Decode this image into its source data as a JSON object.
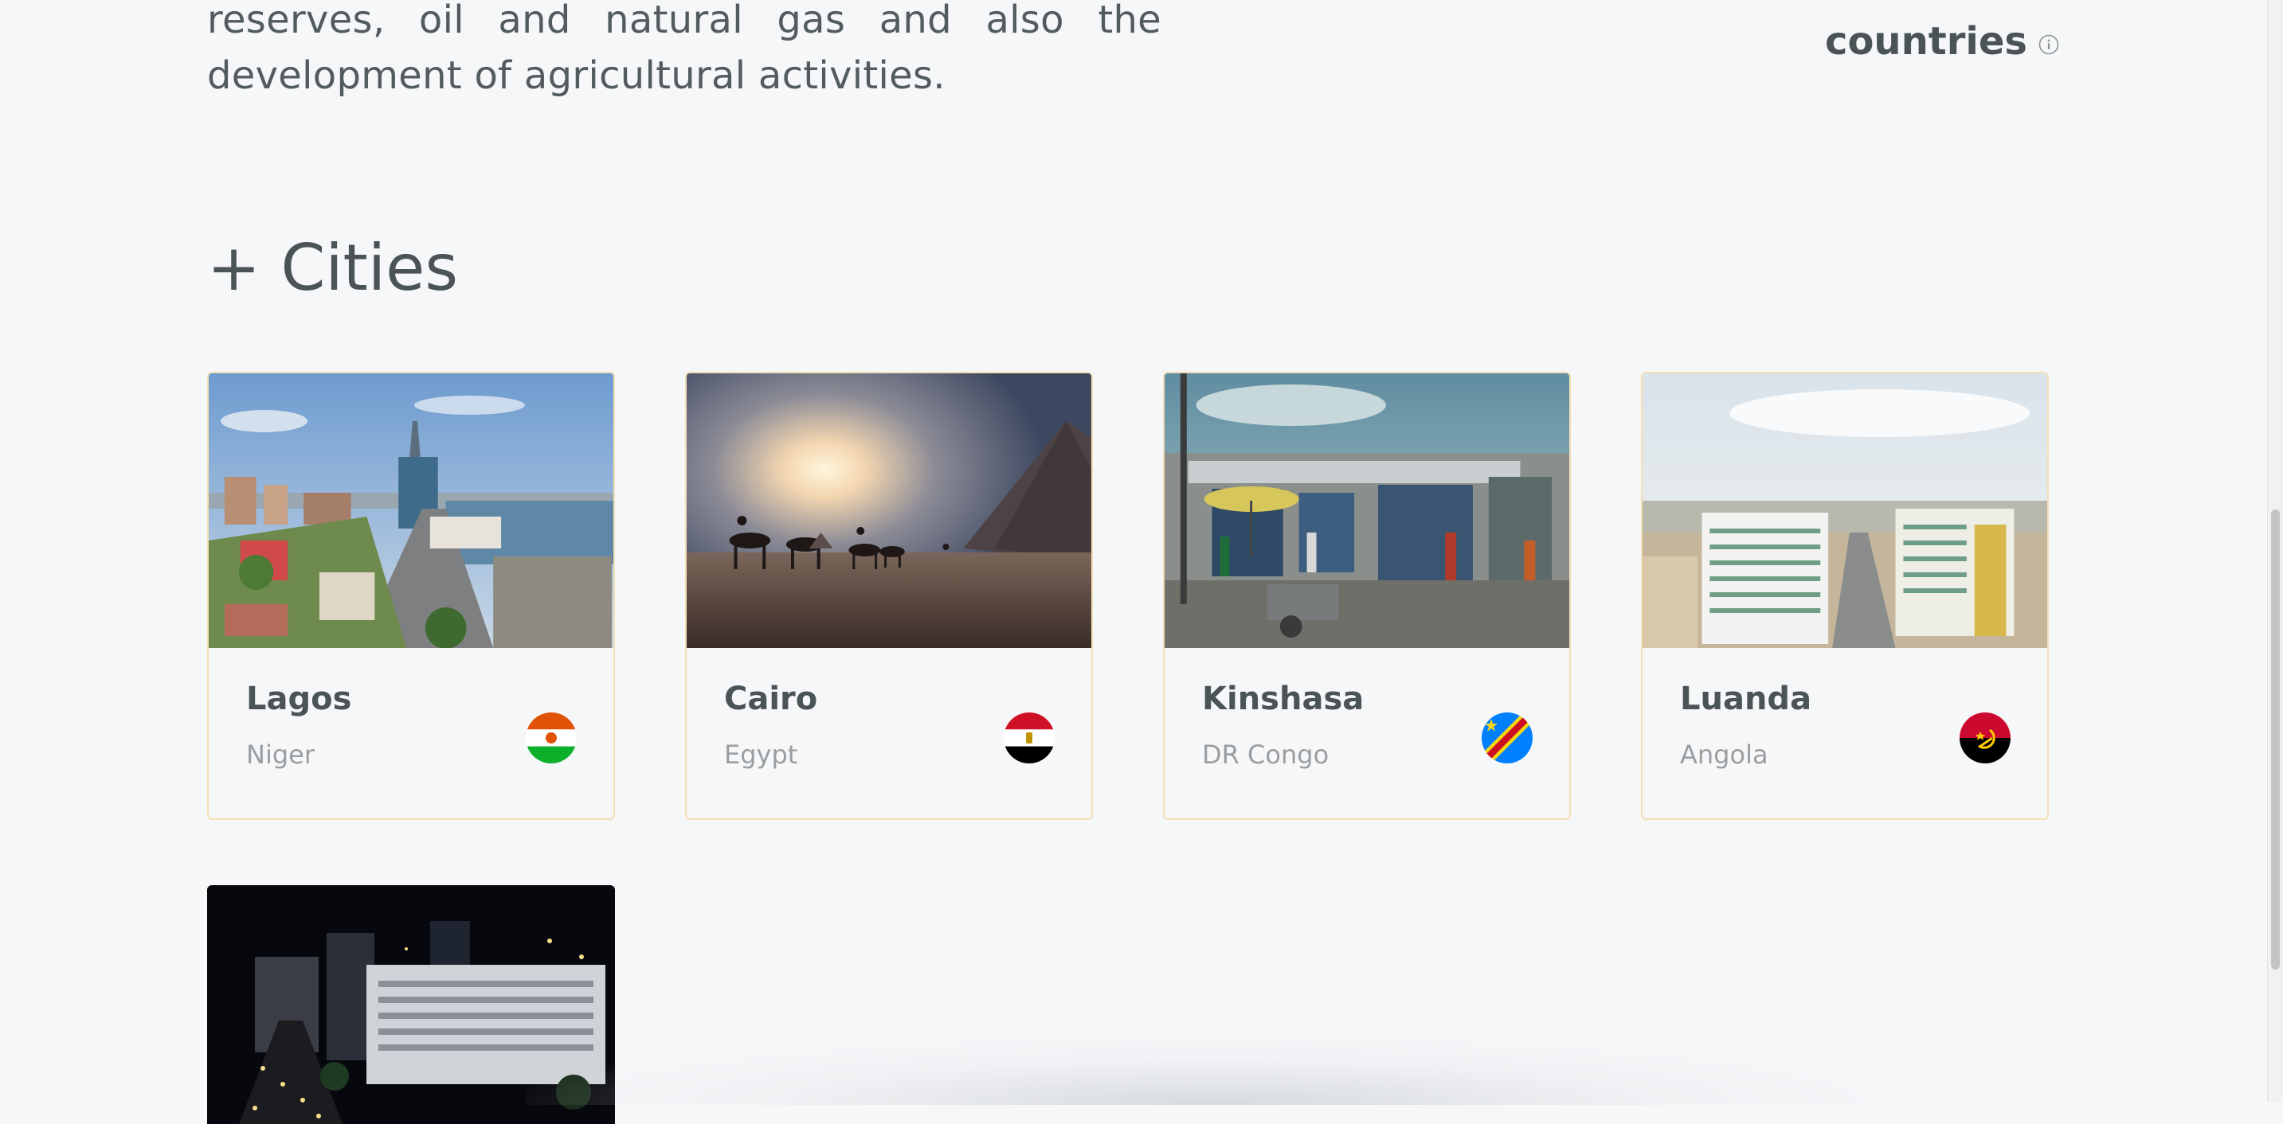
{
  "intro": {
    "text": "reserves, oil and natural gas and also the development of agricultural activities."
  },
  "stats": {
    "countries_label": "countries",
    "info_icon": "info-icon"
  },
  "section": {
    "title": "+ Cities"
  },
  "cities": [
    {
      "name": "Lagos",
      "country": "Niger",
      "flag": "niger-flag"
    },
    {
      "name": "Cairo",
      "country": "Egypt",
      "flag": "egypt-flag"
    },
    {
      "name": "Kinshasa",
      "country": "DR Congo",
      "flag": "dr-congo-flag"
    },
    {
      "name": "Luanda",
      "country": "Angola",
      "flag": "angola-flag"
    }
  ],
  "colors": {
    "background": "#f6f7f9",
    "heading_text": "#4a5456",
    "muted_text": "#9b9ea0",
    "card_border": "#f3dfb5"
  }
}
